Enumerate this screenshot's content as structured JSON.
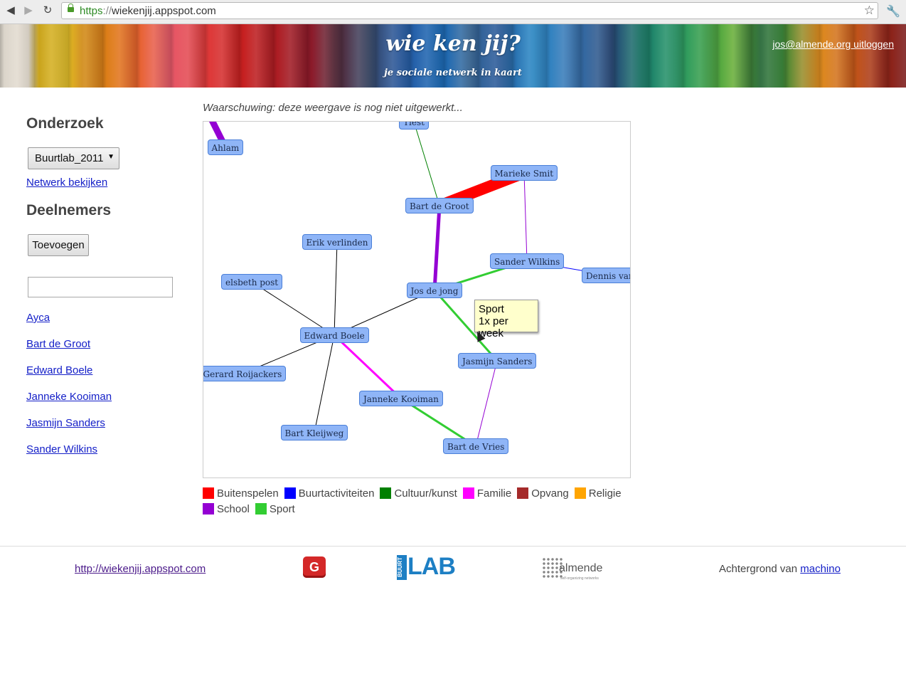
{
  "browser": {
    "url_scheme": "https",
    "url_sep": "://",
    "url_host": "wiekenjij.appspot.com"
  },
  "header": {
    "title": "wie ken jij?",
    "subtitle": "je sociale netwerk in kaart",
    "logout": "jos@almende.org uitloggen"
  },
  "sidebar": {
    "research_heading": "Onderzoek",
    "research_selected": "Buurtlab_2011",
    "view_network": "Netwerk bekijken",
    "participants_heading": "Deelnemers",
    "add_button": "Toevoegen",
    "search_value": "",
    "participants": [
      "Ayca",
      "Bart de Groot",
      "Edward Boele",
      "Janneke Kooiman",
      "Jasmijn Sanders",
      "Sander Wilkins"
    ]
  },
  "main": {
    "warning": "Waarschuwing: deze weergave is nog niet uitgewerkt...",
    "tooltip_line1": "Sport",
    "tooltip_line2": "1x per week"
  },
  "graph": {
    "nodes": [
      {
        "id": "top",
        "label": "Tiest"
      },
      {
        "id": "ahlam",
        "label": "Ahlam"
      },
      {
        "id": "marieke",
        "label": "Marieke Smit"
      },
      {
        "id": "bartg",
        "label": "Bart de Groot"
      },
      {
        "id": "erik",
        "label": "Erik verlinden"
      },
      {
        "id": "sander",
        "label": "Sander Wilkins"
      },
      {
        "id": "dennis",
        "label": "Dennis van"
      },
      {
        "id": "elsbeth",
        "label": "elsbeth post"
      },
      {
        "id": "jos",
        "label": "Jos de jong"
      },
      {
        "id": "edward",
        "label": "Edward Boele"
      },
      {
        "id": "jasmijn",
        "label": "Jasmijn Sanders"
      },
      {
        "id": "gerard",
        "label": "Gerard Roijackers"
      },
      {
        "id": "janneke",
        "label": "Janneke Kooiman"
      },
      {
        "id": "bartk",
        "label": "Bart Kleijweg"
      },
      {
        "id": "bartv",
        "label": "Bart de Vries"
      }
    ],
    "edges": [
      {
        "from": "top",
        "to": "bartg",
        "category": "Cultuur/kunst"
      },
      {
        "from": "bartg",
        "to": "marieke",
        "category": "Buitenspelen"
      },
      {
        "from": "marieke",
        "to": "sander",
        "category": "School"
      },
      {
        "from": "bartg",
        "to": "jos",
        "category": "School"
      },
      {
        "from": "sander",
        "to": "dennis",
        "category": "Buurtactiviteiten"
      },
      {
        "from": "jos",
        "to": "sander",
        "category": "Sport"
      },
      {
        "from": "jos",
        "to": "jasmijn",
        "category": "Sport"
      },
      {
        "from": "jos",
        "to": "edward",
        "category": "none"
      },
      {
        "from": "erik",
        "to": "edward",
        "category": "none"
      },
      {
        "from": "elsbeth",
        "to": "edward",
        "category": "none"
      },
      {
        "from": "gerard",
        "to": "edward",
        "category": "none"
      },
      {
        "from": "bartk",
        "to": "edward",
        "category": "none"
      },
      {
        "from": "edward",
        "to": "janneke",
        "category": "Familie"
      },
      {
        "from": "janneke",
        "to": "bartv",
        "category": "Sport"
      },
      {
        "from": "jasmijn",
        "to": "bartv",
        "category": "School"
      },
      {
        "from": "ahlam",
        "to": "offscreen",
        "category": "School"
      }
    ]
  },
  "legend": [
    {
      "label": "Buitenspelen",
      "color": "#ff0000"
    },
    {
      "label": "Buurtactiviteiten",
      "color": "#0000ff"
    },
    {
      "label": "Cultuur/kunst",
      "color": "#008000"
    },
    {
      "label": "Familie",
      "color": "#ff00ff"
    },
    {
      "label": "Opvang",
      "color": "#a52a2a"
    },
    {
      "label": "Religie",
      "color": "#ffa500"
    },
    {
      "label": "School",
      "color": "#9400d3"
    },
    {
      "label": "Sport",
      "color": "#32cd32"
    }
  ],
  "footer": {
    "link": "http://wiekenjij.appspot.com",
    "g_logo": "G",
    "buurtlab_small": "BUURT",
    "buurtlab_big": "LAB",
    "almende": "almende",
    "almende_tag": "self-organizing networks",
    "credit_text": "Achtergrond van",
    "credit_link": "machino"
  }
}
